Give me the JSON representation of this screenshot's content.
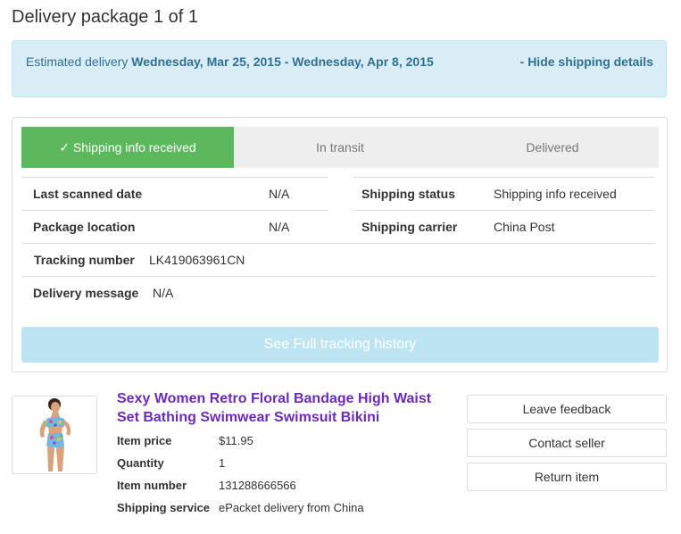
{
  "page": {
    "title": "Delivery package 1 of 1"
  },
  "estimate": {
    "prefix": "Estimated delivery ",
    "range": "Wednesday, Mar 25, 2015 - Wednesday, Apr 8, 2015",
    "hide_link": "- Hide shipping details"
  },
  "progress": {
    "steps": [
      {
        "label": "✓ Shipping info received",
        "active": true
      },
      {
        "label": "In transit",
        "active": false
      },
      {
        "label": "Delivered",
        "active": false
      }
    ],
    "colors": {
      "active": "#5cb85c",
      "inactive": "#eeeeee"
    }
  },
  "tracking_info": {
    "last_scanned": {
      "label": "Last scanned date",
      "value": "N/A"
    },
    "package_location": {
      "label": "Package location",
      "value": "N/A"
    },
    "shipping_status": {
      "label": "Shipping status",
      "value": "Shipping info received"
    },
    "shipping_carrier": {
      "label": "Shipping carrier",
      "value": "China Post"
    },
    "tracking_number": {
      "label": "Tracking number",
      "value": "LK419063961CN"
    },
    "delivery_message": {
      "label": "Delivery message",
      "value": "N/A"
    }
  },
  "history_button": "See Full tracking history",
  "item": {
    "title": "Sexy Women Retro Floral Bandage High Waist Set Bathing Swimwear Swimsuit Bikini",
    "details": [
      {
        "label": "Item price",
        "value": "$11.95"
      },
      {
        "label": "Quantity",
        "value": "1"
      },
      {
        "label": "Item number",
        "value": "131288666566"
      },
      {
        "label": "Shipping service",
        "value": "ePacket delivery from China"
      }
    ],
    "title_color": "#6b2bb8"
  },
  "actions": {
    "leave_feedback": "Leave feedback",
    "contact_seller": "Contact seller",
    "return_item": "Return item"
  }
}
